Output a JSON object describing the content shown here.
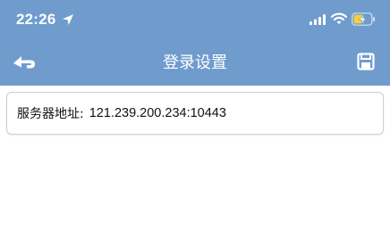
{
  "status_bar": {
    "time": "22:26",
    "icons": [
      "location-arrow-icon",
      "signal-icon",
      "wifi-icon",
      "battery-charging-icon"
    ]
  },
  "header": {
    "title": "登录设置",
    "back_icon": "back-arrow-icon",
    "save_icon": "floppy-disk-icon"
  },
  "form": {
    "server_label": "服务器地址:",
    "server_value": "121.239.200.234:10443"
  },
  "colors": {
    "header_bg": "#6f9ccd",
    "header_text": "#ffffff",
    "battery_charge": "#f3d23a"
  }
}
